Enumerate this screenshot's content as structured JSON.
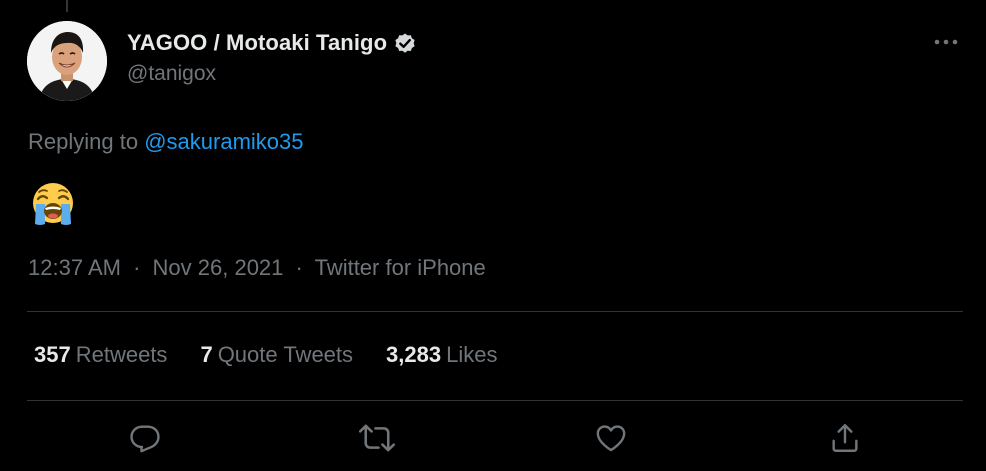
{
  "tweet": {
    "author": {
      "display_name": "YAGOO / Motoaki Tanigo",
      "handle": "@tanigox",
      "verified": true,
      "avatar_icon": "profile-photo"
    },
    "replying_prefix": "Replying to",
    "replying_to": "@sakuramiko35",
    "content_emoji": "loudly-crying-face-emoji",
    "time": "12:37 AM",
    "separator": "·",
    "date": "Nov 26, 2021",
    "source": "Twitter for iPhone",
    "stats": {
      "retweets_count": "357",
      "retweets_label": "Retweets",
      "quote_count": "7",
      "quote_label": "Quote Tweets",
      "likes_count": "3,283",
      "likes_label": "Likes"
    },
    "actions": [
      "reply-icon",
      "retweet-icon",
      "like-icon",
      "share-icon"
    ]
  },
  "colors": {
    "background": "#000000",
    "text_primary": "#e7e9ea",
    "text_secondary": "#71767b",
    "link": "#1d9bf0",
    "divider": "#2f3336"
  }
}
